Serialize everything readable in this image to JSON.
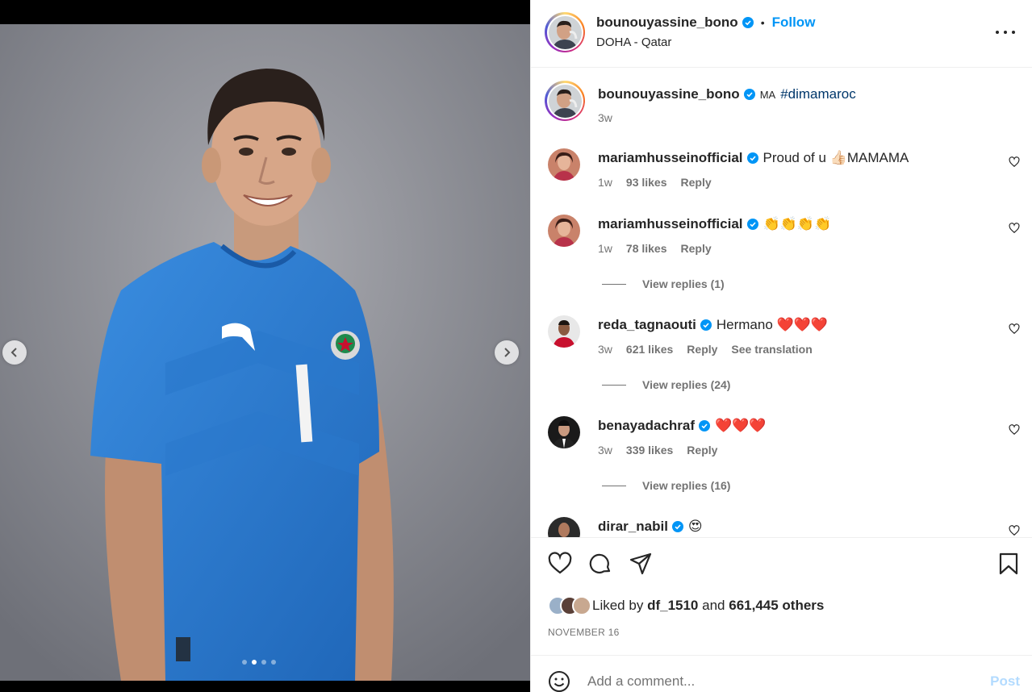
{
  "media": {
    "prev_icon": "chevron-left-icon",
    "next_icon": "chevron-right-icon",
    "carousel": {
      "count": 4,
      "active_index": 1
    },
    "jersey_number": "1"
  },
  "header": {
    "username": "bounouyassine_bono",
    "separator": "•",
    "follow_label": "Follow",
    "location": "DOHA - Qatar",
    "more_icon": "more-options-icon"
  },
  "caption": {
    "username": "bounouyassine_bono",
    "flag_text": "MA",
    "hashtag": "#dimamaroc",
    "time": "3w"
  },
  "comments": [
    {
      "username": "mariamhusseinofficial",
      "text": "Proud of u 👍🏻MAMAMA",
      "time": "1w",
      "likes": "93 likes",
      "reply": "Reply",
      "translation": "",
      "view_replies": ""
    },
    {
      "username": "mariamhusseinofficial",
      "text": "👏👏👏👏",
      "time": "1w",
      "likes": "78 likes",
      "reply": "Reply",
      "translation": "",
      "view_replies": "View replies (1)"
    },
    {
      "username": "reda_tagnaouti",
      "text": "Hermano ❤️❤️❤️",
      "time": "3w",
      "likes": "621 likes",
      "reply": "Reply",
      "translation": "See translation",
      "view_replies": "View replies (24)"
    },
    {
      "username": "benayadachraf",
      "text": "❤️❤️❤️",
      "time": "3w",
      "likes": "339 likes",
      "reply": "Reply",
      "translation": "",
      "view_replies": "View replies (16)"
    },
    {
      "username": "dirar_nabil",
      "text": "😍",
      "time": "",
      "likes": "",
      "reply": "",
      "translation": "",
      "view_replies": ""
    }
  ],
  "actions": {
    "like_icon": "heart-icon",
    "comment_icon": "comment-icon",
    "share_icon": "send-icon",
    "save_icon": "bookmark-icon"
  },
  "likes": {
    "prefix": "Liked by",
    "user": "df_1510",
    "and": "and",
    "others": "661,445 others"
  },
  "date": "NOVEMBER 16",
  "add_comment": {
    "placeholder": "Add a comment...",
    "post_label": "Post",
    "emoji_icon": "emoji-icon"
  },
  "colors": {
    "accent": "#0095f6",
    "post_disabled": "#b3dbff",
    "verified": "#0095f6",
    "jersey": "#2f7fd4",
    "muted_text": "#737373"
  }
}
